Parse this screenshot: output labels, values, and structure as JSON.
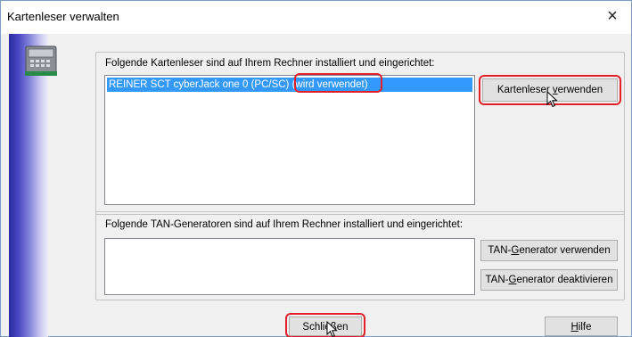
{
  "window": {
    "title": "Kartenleser verwalten",
    "close_glyph": "×"
  },
  "readers": {
    "label": "Folgende Kartenleser sind auf Ihrem Rechner installiert und eingerichtet:",
    "items": [
      {
        "name": "REINER SCT cyberJack one 0 (PC/SC)",
        "status": "(wird verwendet)",
        "selected": true
      }
    ],
    "use_button": {
      "pre": "Kartenleser ",
      "accel": "v",
      "post": "erwenden"
    }
  },
  "tan": {
    "label": "Folgende TAN-Generatoren sind auf Ihrem Rechner installiert und eingerichtet:",
    "items": [],
    "use_button": {
      "pre": "TAN-",
      "accel": "G",
      "post": "enerator verwenden"
    },
    "deactivate_button": {
      "pre": "TAN-",
      "accel": "G",
      "post": "enerator deaktivieren"
    }
  },
  "footer": {
    "close_button": "Schließen",
    "help_button": {
      "pre": "",
      "accel": "H",
      "post": "ilfe"
    }
  },
  "colors": {
    "selection": "#3399ff",
    "highlight_frame": "#e2202a",
    "sidebar_dark": "#2c2aa0"
  },
  "icons": {
    "card_reader": "card-reader-icon",
    "cursor": "mouse-pointer-icon"
  }
}
